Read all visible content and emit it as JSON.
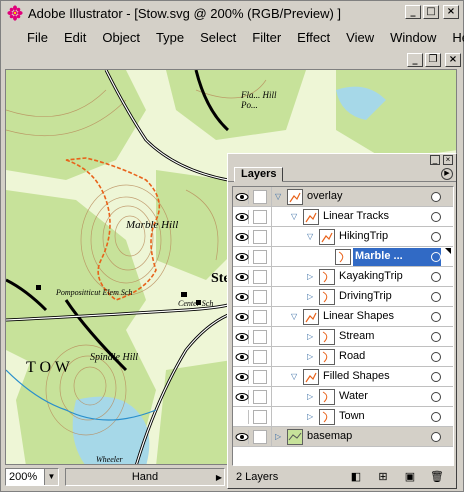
{
  "window": {
    "title": "Adobe Illustrator - [Stow.svg @ 200% (RGB/Preview) ]",
    "controls": [
      "minimize",
      "maximize",
      "close"
    ]
  },
  "menu": {
    "items": [
      "File",
      "Edit",
      "Object",
      "Type",
      "Select",
      "Filter",
      "Effect",
      "View",
      "Window",
      "Help"
    ]
  },
  "map": {
    "labels": [
      "Marble Hill",
      "Pompositticut Elem Sch",
      "Center Sch",
      "Spindle Hill",
      "Ste",
      "T  O  W",
      "Wheeler",
      "Fla... Hill",
      "Po..."
    ]
  },
  "status": {
    "zoom": "200%",
    "tool": "Hand"
  },
  "layers_panel": {
    "tab": "Layers",
    "count": "2 Layers",
    "rows": [
      {
        "name": "overlay",
        "level": 0,
        "expanded": true,
        "visible": true,
        "selected": false
      },
      {
        "name": "Linear Tracks",
        "level": 1,
        "expanded": true,
        "visible": true,
        "selected": false
      },
      {
        "name": "HikingTrip",
        "level": 2,
        "expanded": true,
        "visible": true,
        "selected": false
      },
      {
        "name": "Marble ...",
        "level": 3,
        "expanded": false,
        "visible": true,
        "selected": true
      },
      {
        "name": "KayakingTrip",
        "level": 2,
        "expanded": false,
        "visible": true,
        "selected": false
      },
      {
        "name": "DrivingTrip",
        "level": 2,
        "expanded": false,
        "visible": true,
        "selected": false
      },
      {
        "name": "Linear Shapes",
        "level": 1,
        "expanded": true,
        "visible": true,
        "selected": false
      },
      {
        "name": "Stream",
        "level": 2,
        "expanded": false,
        "visible": true,
        "selected": false
      },
      {
        "name": "Road",
        "level": 2,
        "expanded": false,
        "visible": true,
        "selected": false
      },
      {
        "name": "Filled Shapes",
        "level": 1,
        "expanded": true,
        "visible": true,
        "selected": false
      },
      {
        "name": "Water",
        "level": 2,
        "expanded": false,
        "visible": true,
        "selected": false
      },
      {
        "name": "Town",
        "level": 2,
        "expanded": false,
        "visible": false,
        "selected": false
      },
      {
        "name": "basemap",
        "level": 0,
        "expanded": false,
        "visible": true,
        "selected": false
      }
    ]
  },
  "colors": {
    "selection": "#316ac5",
    "map_green": "#c7e29a",
    "map_paper": "#eef6d6",
    "trail": "#e8621a",
    "water": "#a6d8e8"
  }
}
